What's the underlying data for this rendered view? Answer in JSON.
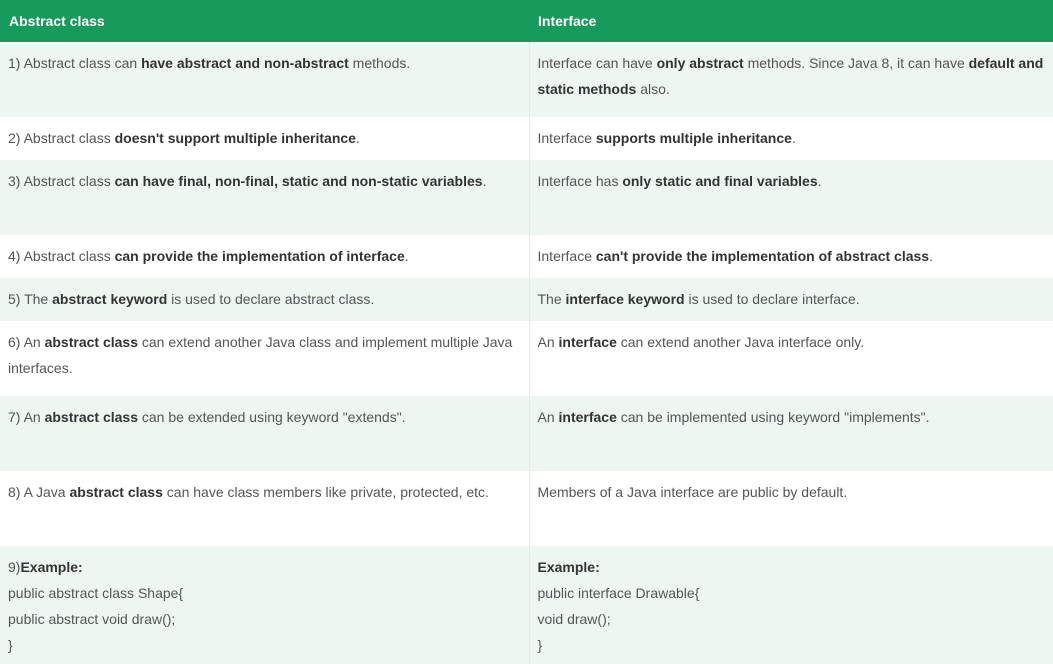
{
  "headers": [
    "Abstract class",
    "Interface"
  ],
  "rows": [
    {
      "left": [
        {
          "t": "1) Abstract class can "
        },
        {
          "t": "have abstract and non-abstract",
          "b": true
        },
        {
          "t": " methods."
        }
      ],
      "right": [
        {
          "t": "Interface can have "
        },
        {
          "t": "only abstract",
          "b": true
        },
        {
          "t": " methods. Since Java 8, it can have "
        },
        {
          "t": "default and static methods",
          "b": true
        },
        {
          "t": " also."
        }
      ]
    },
    {
      "left": [
        {
          "t": "2) Abstract class "
        },
        {
          "t": "doesn't support multiple inheritance",
          "b": true
        },
        {
          "t": "."
        }
      ],
      "right": [
        {
          "t": "Interface "
        },
        {
          "t": "supports multiple inheritance",
          "b": true
        },
        {
          "t": "."
        }
      ]
    },
    {
      "left": [
        {
          "t": "3) Abstract class "
        },
        {
          "t": "can have final, non-final, static and non-static variables",
          "b": true
        },
        {
          "t": "."
        }
      ],
      "right": [
        {
          "t": "Interface has "
        },
        {
          "t": "only static and final variables",
          "b": true
        },
        {
          "t": "."
        }
      ]
    },
    {
      "left": [
        {
          "t": "4) Abstract class "
        },
        {
          "t": "can provide the implementation of interface",
          "b": true
        },
        {
          "t": "."
        }
      ],
      "right": [
        {
          "t": "Interface "
        },
        {
          "t": "can't provide the implementation of abstract class",
          "b": true
        },
        {
          "t": "."
        }
      ]
    },
    {
      "left": [
        {
          "t": "5) The "
        },
        {
          "t": "abstract keyword",
          "b": true
        },
        {
          "t": " is used to declare abstract class."
        }
      ],
      "right": [
        {
          "t": "The "
        },
        {
          "t": "interface keyword",
          "b": true
        },
        {
          "t": " is used to declare interface."
        }
      ]
    },
    {
      "left": [
        {
          "t": "6) An "
        },
        {
          "t": "abstract class",
          "b": true
        },
        {
          "t": " can extend another Java class and implement multiple Java interfaces."
        }
      ],
      "right": [
        {
          "t": "An "
        },
        {
          "t": "interface",
          "b": true
        },
        {
          "t": " can extend another Java interface only."
        }
      ]
    },
    {
      "left": [
        {
          "t": "7) An "
        },
        {
          "t": "abstract class",
          "b": true
        },
        {
          "t": " can be extended using keyword \"extends\"."
        }
      ],
      "right": [
        {
          "t": "An "
        },
        {
          "t": "interface",
          "b": true
        },
        {
          "t": " can be implemented using keyword \"implements\"."
        }
      ]
    },
    {
      "left": [
        {
          "t": "8) A Java "
        },
        {
          "t": "abstract class",
          "b": true
        },
        {
          "t": " can have class members like private, protected, etc."
        }
      ],
      "right": [
        {
          "t": "Members of a Java interface are public by default."
        }
      ]
    }
  ],
  "example": {
    "left_prefix": "9)",
    "label": "Example:",
    "left_code": [
      "public abstract class Shape{",
      "public abstract void draw();",
      "}"
    ],
    "right_code": [
      "public interface Drawable{",
      "void draw();",
      "}"
    ]
  },
  "colors": {
    "header_bg": "#179b5c",
    "stripe_bg": "#eef6f1",
    "text": "#555555",
    "bold_text": "#333333"
  }
}
